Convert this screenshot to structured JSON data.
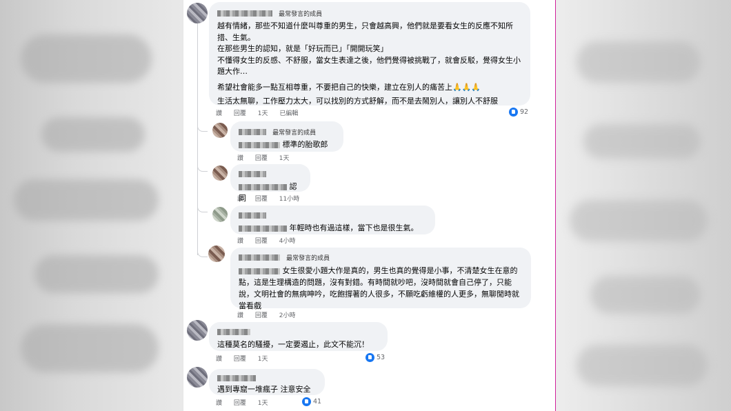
{
  "comments": [
    {
      "badge": "最常發言的成員",
      "lines": [
        "越有情緒，那些不知道什麼叫尊重的男生，只會越高興，他們就是要看女生的反應不知所措、生氣。",
        "在那些男生的認知，就是「好玩而已」「開開玩笑」",
        "不懂得女生的反感、不舒服，當女生表達之後，他們覺得被挑戰了，就會反駁，覺得女生小題大作…",
        "希望社會能多一點互相尊重，不要把自己的快樂，建立在別人的痛苦上🙏🙏🙏",
        "生活太無聊，工作壓力太大，可以找別的方式舒解，而不是去鬧別人，讓別人不舒服"
      ],
      "actions": [
        "讚",
        "回覆",
        "1天",
        "已編輯"
      ],
      "likes": "92"
    },
    {
      "badge": "最常發言的成員",
      "text": "標準的胎歌郎",
      "actions": [
        "讚",
        "回覆",
        "1天"
      ]
    },
    {
      "text": "認同",
      "actions": [
        "讚",
        "回覆",
        "11小時"
      ]
    },
    {
      "text": "年輕時也有過這樣，當下也是很生氣。",
      "actions": [
        "讚",
        "回覆",
        "4小時"
      ]
    },
    {
      "badge": "最常發言的成員",
      "text": "女生很愛小題大作是真的，男生也真的覺得是小事，不清楚女生在意的點，這是生理構造的問題，沒有對錯。有時間就吵吧，沒時間就會自己停了，只能說，文明社會的無病呻吟，吃飽撐著的人很多，不願吃虧維權的人更多，無聊閒時就當看戲",
      "actions": [
        "讚",
        "回覆",
        "2小時"
      ]
    },
    {
      "text": "這種莫名的騷擾，一定要遏止，此文不能沉！",
      "actions": [
        "讚",
        "回覆",
        "1天"
      ],
      "likes": "53"
    },
    {
      "text": "遇到專窟一堆瘋子 注意安全",
      "actions": [
        "讚",
        "回覆",
        "1天"
      ],
      "likes": "41"
    }
  ],
  "colors": {
    "like_blue": "#1877f2",
    "bubble_bg": "#f0f2f5",
    "meta_gray": "#65676b",
    "divider": "#d0209a"
  }
}
